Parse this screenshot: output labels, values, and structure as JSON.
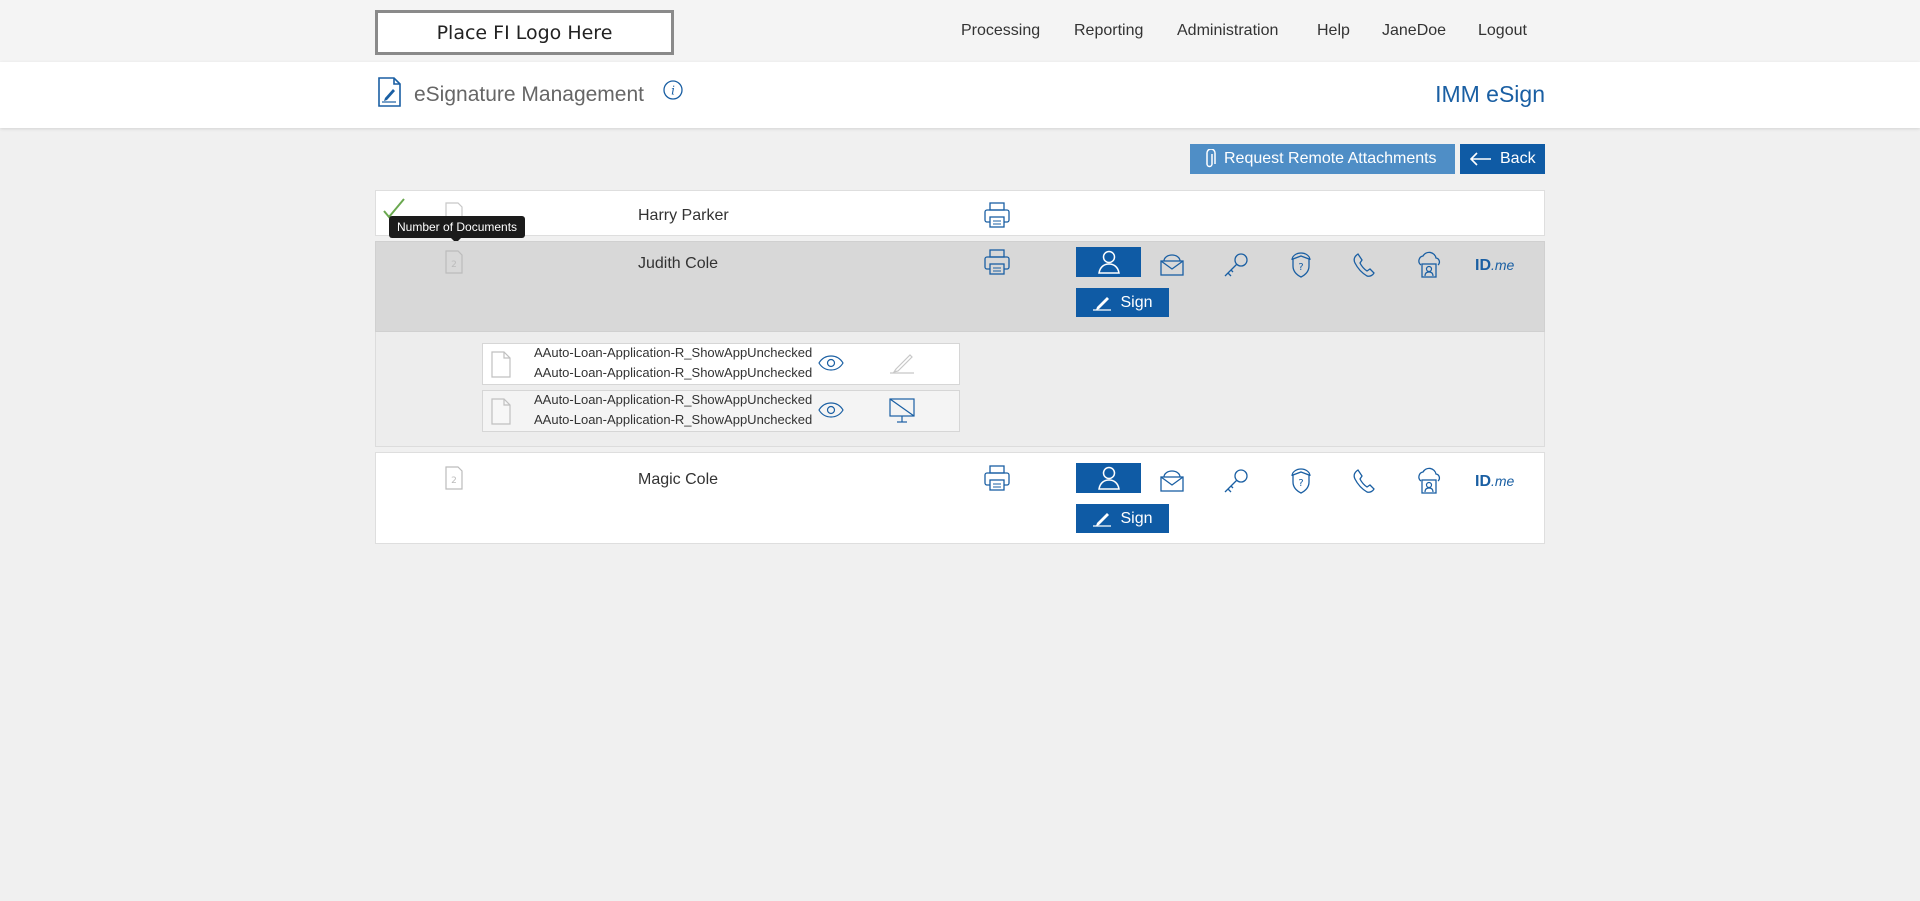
{
  "header": {
    "logo_text": "Place FI Logo Here",
    "nav": [
      {
        "label": "Processing"
      },
      {
        "label": "Reporting"
      },
      {
        "label": "Administration"
      },
      {
        "label": "Help"
      },
      {
        "label": "JaneDoe"
      },
      {
        "label": "Logout"
      }
    ]
  },
  "page": {
    "title": "eSignature Management",
    "app_name": "IMM eSign"
  },
  "actions": {
    "request_attachments_label": "Request Remote Attachments",
    "back_label": "Back"
  },
  "tooltip": "Number of Documents",
  "signers": [
    {
      "name": "Harry Parker",
      "status": "completed",
      "doc_count": "2"
    },
    {
      "name": "Judith Cole",
      "doc_count": "2",
      "sign_label": "Sign",
      "idme_label": "ID",
      "idme_suffix": ".me",
      "documents": [
        {
          "line1": "AAuto-Loan-Application-R_ShowAppUnchecked",
          "line2": "AAuto-Loan-Application-R_ShowAppUnchecked"
        },
        {
          "line1": "AAuto-Loan-Application-R_ShowAppUnchecked",
          "line2": "AAuto-Loan-Application-R_ShowAppUnchecked"
        }
      ]
    },
    {
      "name": "Magic Cole",
      "doc_count": "2",
      "sign_label": "Sign",
      "idme_label": "ID",
      "idme_suffix": ".me"
    }
  ],
  "colors": {
    "primary": "#0f5ba5",
    "secondary_button": "#4f8ec6",
    "link_blue": "#1a5fa3",
    "selected_row": "#d8d8d8",
    "check_green": "#6aa84f"
  }
}
